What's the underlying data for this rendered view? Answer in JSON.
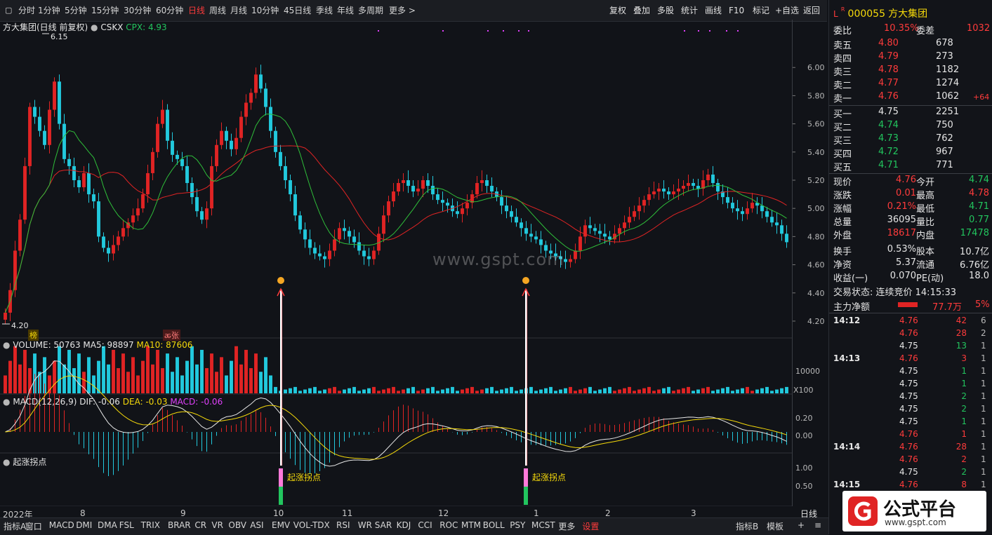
{
  "toolbar": {
    "periods": [
      "分时",
      "1分钟",
      "5分钟",
      "15分钟",
      "30分钟",
      "60分钟",
      "日线",
      "周线",
      "月线",
      "10分钟",
      "45日线",
      "季线",
      "年线",
      "多周期",
      "更多 >"
    ],
    "active_period": "日线",
    "right": [
      "复权",
      "叠加",
      "多股",
      "统计",
      "画线",
      "F10",
      "标记",
      "+自选",
      "返回"
    ]
  },
  "chart_title": {
    "name": "方大集团(日线 前复权)",
    "indicator": "CSKX",
    "cpx": "CPX: 4.93"
  },
  "watermark": "www.gspt.com",
  "annotations": {
    "high_label": "6.15",
    "low_label": "4.20",
    "bang": "榜",
    "zhang": "ꬱ张",
    "signal_text": "起涨拐点"
  },
  "volume_pane": {
    "title": "VOLUME: 50763",
    "ma5": "MA5: 98897",
    "ma10": "MA10: 87606",
    "tick": "10000",
    "unit": "X100"
  },
  "macd_pane": {
    "title": "MACD(12,26,9)",
    "dif": "DIF: -0.06",
    "dea": "DEA: -0.03",
    "macd": "MACD: -0.06",
    "ticks": [
      "0.20",
      "0.00"
    ]
  },
  "signal_pane": {
    "title": "起涨拐点",
    "ticks": [
      "1.00",
      "0.50"
    ]
  },
  "x_axis": {
    "labels": [
      "2022年",
      "8",
      "9",
      "10",
      "11",
      "12",
      "1",
      "2",
      "3"
    ],
    "end_label": "日线"
  },
  "bottom_tabs": [
    "指标A",
    "窗口",
    "MACD",
    "DMI",
    "DMA",
    "FSL",
    "TRIX",
    "BRAR",
    "CR",
    "VR",
    "OBV",
    "ASI",
    "EMV",
    "VOL-TDX",
    "RSI",
    "WR",
    "SAR",
    "KDJ",
    "CCI",
    "ROC",
    "MTM",
    "BOLL",
    "PSY",
    "MCST",
    "更多",
    "设置"
  ],
  "bottom_right": [
    "指标B",
    "模板",
    "+",
    "≡"
  ],
  "quote": {
    "code": "000055",
    "name": "方大集团",
    "weibi_label": "委比",
    "weibi": "10.35%",
    "weicha_label": "委差",
    "weicha": "1032",
    "asks": [
      {
        "label": "卖五",
        "price": "4.80",
        "vol": "678",
        "chg": ""
      },
      {
        "label": "卖四",
        "price": "4.79",
        "vol": "273",
        "chg": ""
      },
      {
        "label": "卖三",
        "price": "4.78",
        "vol": "1182",
        "chg": ""
      },
      {
        "label": "卖二",
        "price": "4.77",
        "vol": "1274",
        "chg": ""
      },
      {
        "label": "卖一",
        "price": "4.76",
        "vol": "1062",
        "chg": "+64"
      }
    ],
    "bids": [
      {
        "label": "买一",
        "price": "4.75",
        "vol": "2251"
      },
      {
        "label": "买二",
        "price": "4.74",
        "vol": "750"
      },
      {
        "label": "买三",
        "price": "4.73",
        "vol": "762"
      },
      {
        "label": "买四",
        "price": "4.72",
        "vol": "967"
      },
      {
        "label": "买五",
        "price": "4.71",
        "vol": "771"
      }
    ],
    "stats": [
      [
        "现价",
        "4.76",
        "今开",
        "4.74"
      ],
      [
        "涨跌",
        "0.01",
        "最高",
        "4.78"
      ],
      [
        "涨幅",
        "0.21%",
        "最低",
        "4.71"
      ],
      [
        "总量",
        "36095",
        "量比",
        "0.77"
      ],
      [
        "外盘",
        "18617",
        "内盘",
        "17478"
      ],
      [
        "换手",
        "0.53%",
        "股本",
        "10.7亿"
      ],
      [
        "净资",
        "5.37",
        "流通",
        "6.76亿"
      ],
      [
        "收益(一)",
        "0.070",
        "PE(动)",
        "18.0"
      ]
    ],
    "trade_status": "交易状态: 连续竞价 14:15:33",
    "main_net_label": "主力净额",
    "main_net": "77.7万",
    "main_net_pct": "5%",
    "ticks": [
      {
        "t": "14:12",
        "p": "4.76",
        "v": "42",
        "n": "6"
      },
      {
        "t": "",
        "p": "4.76",
        "v": "28",
        "n": "2"
      },
      {
        "t": "",
        "p": "4.75",
        "v": "13",
        "n": "1"
      },
      {
        "t": "14:13",
        "p": "4.76",
        "v": "3",
        "n": "1"
      },
      {
        "t": "",
        "p": "4.75",
        "v": "1",
        "n": "1"
      },
      {
        "t": "",
        "p": "4.75",
        "v": "1",
        "n": "1"
      },
      {
        "t": "",
        "p": "4.75",
        "v": "2",
        "n": "1"
      },
      {
        "t": "",
        "p": "4.75",
        "v": "2",
        "n": "1"
      },
      {
        "t": "",
        "p": "4.75",
        "v": "1",
        "n": "1"
      },
      {
        "t": "",
        "p": "4.76",
        "v": "1",
        "n": "1"
      },
      {
        "t": "14:14",
        "p": "4.76",
        "v": "28",
        "n": "1"
      },
      {
        "t": "",
        "p": "4.76",
        "v": "2",
        "n": "1"
      },
      {
        "t": "",
        "p": "4.75",
        "v": "2",
        "n": "1"
      },
      {
        "t": "14:15",
        "p": "4.76",
        "v": "8",
        "n": "1"
      }
    ]
  },
  "logo_text": {
    "main": "公式平台",
    "url": "www.gspt.com"
  },
  "chart_data": {
    "type": "candlestick",
    "y_ticks": [
      6.0,
      5.8,
      5.6,
      5.4,
      5.2,
      5.0,
      4.8,
      4.6,
      4.4,
      4.2
    ],
    "ylim": [
      4.15,
      6.25
    ],
    "closes": [
      4.26,
      4.42,
      4.7,
      4.92,
      5.3,
      5.72,
      5.65,
      5.55,
      5.45,
      5.7,
      5.9,
      5.6,
      5.35,
      5.3,
      5.2,
      5.15,
      5.25,
      5.1,
      5.05,
      4.8,
      4.72,
      4.68,
      4.74,
      4.8,
      4.86,
      4.9,
      4.95,
      5.0,
      5.1,
      5.25,
      5.4,
      5.6,
      5.7,
      5.48,
      5.38,
      5.35,
      5.3,
      5.18,
      5.08,
      4.98,
      4.92,
      5.0,
      5.3,
      5.45,
      5.55,
      5.48,
      5.42,
      5.5,
      5.65,
      5.75,
      5.82,
      5.95,
      5.85,
      5.72,
      5.55,
      5.4,
      5.3,
      5.2,
      5.1,
      4.95,
      4.85,
      4.78,
      4.72,
      4.68,
      4.66,
      4.64,
      4.7,
      4.78,
      4.86,
      4.84,
      4.8,
      4.76,
      4.7,
      4.66,
      4.64,
      4.7,
      4.82,
      4.95,
      5.05,
      5.12,
      5.18,
      5.2,
      5.16,
      5.12,
      5.14,
      5.2,
      5.16,
      5.1,
      5.06,
      5.04,
      5.02,
      4.98,
      4.96,
      5.0,
      5.04,
      5.1,
      5.18,
      5.2,
      5.16,
      5.12,
      5.08,
      5.02,
      4.98,
      4.94,
      4.9,
      4.86,
      4.82,
      4.8,
      4.78,
      4.74,
      4.7,
      4.68,
      4.66,
      4.64,
      4.62,
      4.64,
      4.7,
      4.8,
      4.88,
      4.86,
      4.84,
      4.82,
      4.8,
      4.78,
      4.82,
      4.86,
      4.9,
      4.94,
      4.98,
      5.02,
      5.06,
      5.1,
      5.12,
      5.14,
      5.12,
      5.1,
      5.12,
      5.14,
      5.16,
      5.18,
      5.16,
      5.14,
      5.2,
      5.24,
      5.18,
      5.12,
      5.08,
      5.04,
      5.0,
      4.98,
      4.96,
      5.0,
      5.04,
      5.02,
      4.98,
      4.94,
      4.9,
      4.88,
      4.82,
      4.76
    ]
  }
}
